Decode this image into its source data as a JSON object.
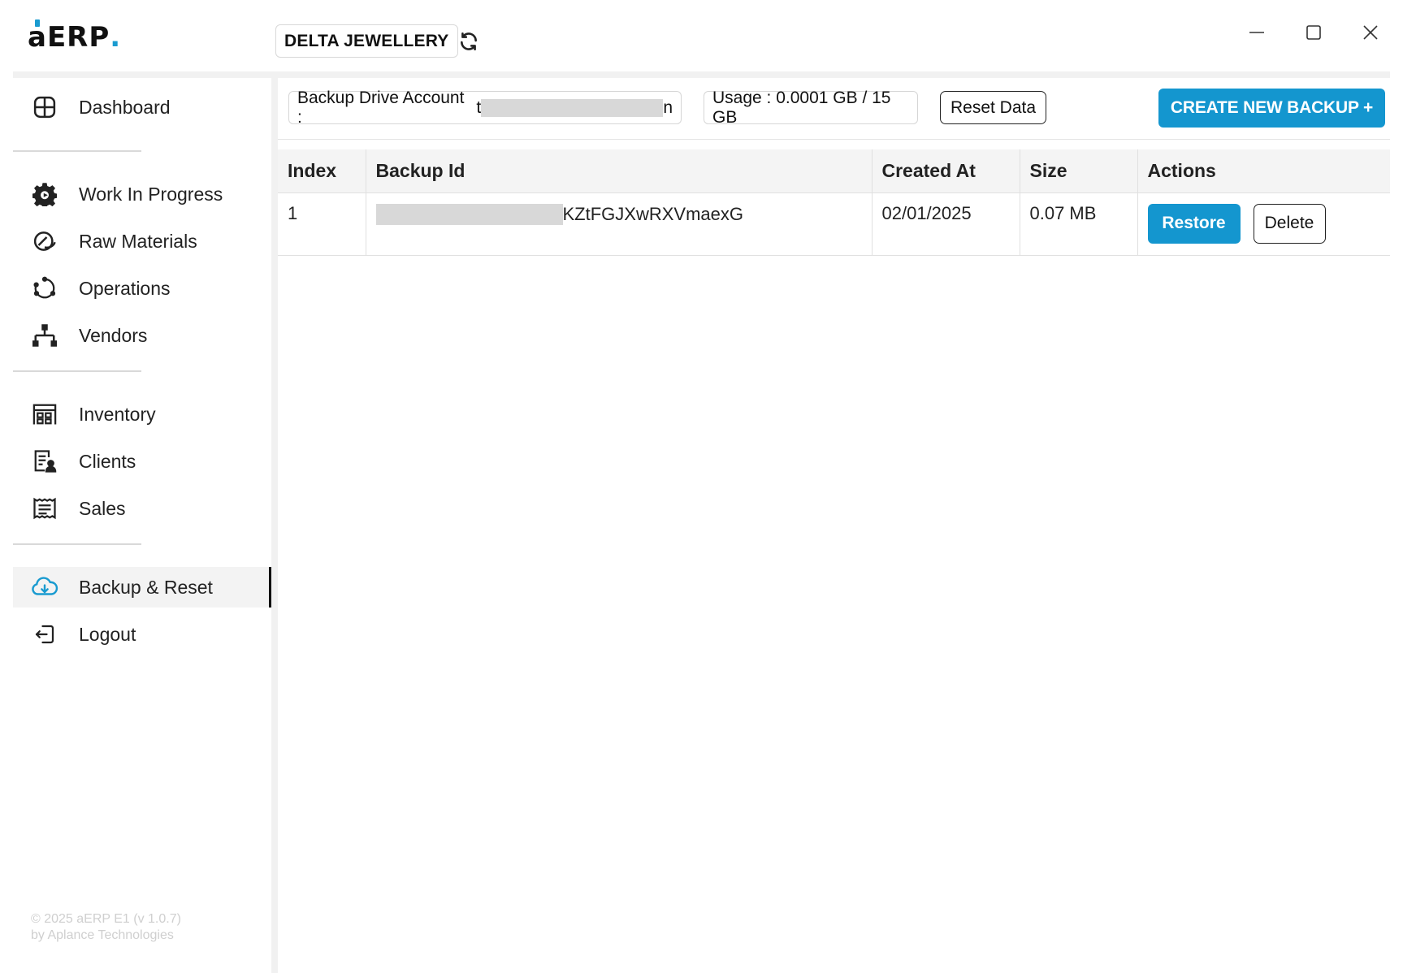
{
  "app": {
    "logo_text": "aERP",
    "logo_dot": ".",
    "company_name": "DELTA JEWELLERY",
    "accent_color": "#1496cf"
  },
  "window_controls": {
    "minimize_icon": "minimize-icon",
    "maximize_icon": "maximize-icon",
    "close_icon": "close-icon"
  },
  "sidebar": {
    "items": [
      {
        "label": "Dashboard",
        "icon": "dashboard-icon"
      },
      {
        "label": "Work In Progress",
        "icon": "gear-icon"
      },
      {
        "label": "Raw Materials",
        "icon": "raw-materials-icon"
      },
      {
        "label": "Operations",
        "icon": "operations-icon"
      },
      {
        "label": "Vendors",
        "icon": "vendors-icon"
      },
      {
        "label": "Inventory",
        "icon": "inventory-icon"
      },
      {
        "label": "Clients",
        "icon": "clients-icon"
      },
      {
        "label": "Sales",
        "icon": "sales-icon"
      },
      {
        "label": "Backup & Reset",
        "icon": "cloud-download-icon",
        "active": true
      },
      {
        "label": "Logout",
        "icon": "logout-icon"
      }
    ],
    "footer_line1": "© 2025 aERP E1 (v 1.0.7)",
    "footer_line2": "by Aplance Technologies"
  },
  "toolbar": {
    "drive_account_label": "Backup Drive Account :",
    "drive_account_prefix": "t",
    "drive_account_suffix": "n",
    "usage_text": "Usage : 0.0001 GB / 15 GB",
    "reset_label": "Reset Data",
    "create_label": "CREATE NEW BACKUP +"
  },
  "table": {
    "columns": [
      "Index",
      "Backup Id",
      "Created At",
      "Size",
      "Actions"
    ],
    "rows": [
      {
        "index": "1",
        "backup_id_visible": "KZtFGJXwRXVmaexG",
        "created_at": "02/01/2025",
        "size": "0.07 MB",
        "restore_label": "Restore",
        "delete_label": "Delete"
      }
    ]
  }
}
